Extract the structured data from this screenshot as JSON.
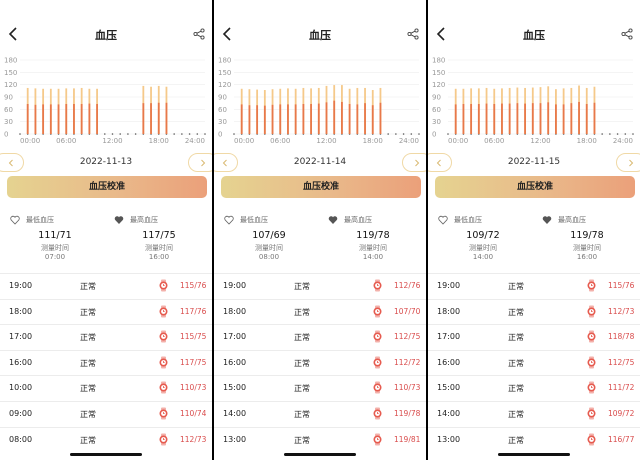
{
  "ui": {
    "title": "血压",
    "calibrate_label": "血压校准",
    "min_label": "最低血压",
    "max_label": "最高血压",
    "measure_time_label": "测量时间",
    "accent_color": "#e65a4e",
    "bar_color": "#e8784a",
    "bar_tip_color": "#f5c98a",
    "icons": [
      "back-arrow-icon",
      "share-icon",
      "chevron-left-icon",
      "chevron-right-icon",
      "heart-outline-icon",
      "heart-filled-icon",
      "watch-icon"
    ]
  },
  "panels": [
    {
      "date": "2022-11-13",
      "min": {
        "value": "111/71",
        "time": "07:00"
      },
      "max": {
        "value": "117/75",
        "time": "16:00"
      },
      "rows": [
        {
          "time": "19:00",
          "status": "正常",
          "value": "115/76"
        },
        {
          "time": "18:00",
          "status": "正常",
          "value": "117/76"
        },
        {
          "time": "17:00",
          "status": "正常",
          "value": "115/75"
        },
        {
          "time": "16:00",
          "status": "正常",
          "value": "117/75"
        },
        {
          "time": "10:00",
          "status": "正常",
          "value": "110/73"
        },
        {
          "time": "09:00",
          "status": "正常",
          "value": "110/74"
        },
        {
          "time": "08:00",
          "status": "正常",
          "value": "112/73"
        }
      ]
    },
    {
      "date": "2022-11-14",
      "min": {
        "value": "107/69",
        "time": "08:00"
      },
      "max": {
        "value": "119/78",
        "time": "14:00"
      },
      "rows": [
        {
          "time": "19:00",
          "status": "正常",
          "value": "112/76"
        },
        {
          "time": "18:00",
          "status": "正常",
          "value": "107/70"
        },
        {
          "time": "17:00",
          "status": "正常",
          "value": "112/75"
        },
        {
          "time": "16:00",
          "status": "正常",
          "value": "112/72"
        },
        {
          "time": "15:00",
          "status": "正常",
          "value": "110/73"
        },
        {
          "time": "14:00",
          "status": "正常",
          "value": "119/78"
        },
        {
          "time": "13:00",
          "status": "正常",
          "value": "119/81"
        }
      ]
    },
    {
      "date": "2022-11-15",
      "min": {
        "value": "109/72",
        "time": "14:00"
      },
      "max": {
        "value": "119/78",
        "time": "16:00"
      },
      "rows": [
        {
          "time": "19:00",
          "status": "正常",
          "value": "115/76"
        },
        {
          "time": "18:00",
          "status": "正常",
          "value": "112/73"
        },
        {
          "time": "17:00",
          "status": "正常",
          "value": "118/78"
        },
        {
          "time": "16:00",
          "status": "正常",
          "value": "112/75"
        },
        {
          "time": "15:00",
          "status": "正常",
          "value": "111/72"
        },
        {
          "time": "14:00",
          "status": "正常",
          "value": "109/72"
        },
        {
          "time": "13:00",
          "status": "正常",
          "value": "116/77"
        }
      ]
    }
  ],
  "chart_data": [
    {
      "type": "bar",
      "title": "",
      "y_ticks": [
        "0",
        "30",
        "60",
        "90",
        "120",
        "150",
        "180"
      ],
      "x_ticks": [
        "00:00",
        "06:00",
        "12:00",
        "18:00",
        "24:00"
      ],
      "ylim": [
        0,
        180
      ],
      "xlim": [
        0,
        24
      ],
      "grid": true,
      "x": [
        1,
        2,
        3,
        4,
        5,
        6,
        7,
        8,
        9,
        10,
        16,
        17,
        18,
        19
      ],
      "series": [
        {
          "values": [
            112,
            111,
            110,
            110,
            110,
            111,
            111,
            112,
            110,
            110,
            117,
            115,
            117,
            115
          ]
        },
        {
          "values": [
            73,
            71,
            72,
            72,
            72,
            73,
            73,
            73,
            74,
            73,
            75,
            75,
            76,
            76
          ]
        }
      ]
    },
    {
      "type": "bar",
      "title": "",
      "y_ticks": [
        "0",
        "30",
        "60",
        "90",
        "120",
        "150",
        "180"
      ],
      "x_ticks": [
        "00:00",
        "06:00",
        "12:00",
        "18:00",
        "24:00"
      ],
      "ylim": [
        0,
        180
      ],
      "xlim": [
        0,
        24
      ],
      "grid": true,
      "x": [
        1,
        2,
        3,
        4,
        5,
        6,
        7,
        8,
        9,
        10,
        11,
        12,
        13,
        14,
        15,
        16,
        17,
        18,
        19
      ],
      "series": [
        {
          "values": [
            110,
            109,
            108,
            107,
            109,
            110,
            111,
            110,
            112,
            111,
            112,
            117,
            119,
            119,
            110,
            112,
            112,
            107,
            112
          ]
        },
        {
          "values": [
            72,
            70,
            70,
            69,
            71,
            72,
            72,
            72,
            73,
            73,
            74,
            77,
            81,
            78,
            73,
            72,
            75,
            70,
            76
          ]
        }
      ]
    },
    {
      "type": "bar",
      "title": "",
      "y_ticks": [
        "0",
        "30",
        "60",
        "90",
        "120",
        "150",
        "180"
      ],
      "x_ticks": [
        "00:00",
        "06:00",
        "12:00",
        "18:00",
        "24:00"
      ],
      "ylim": [
        0,
        180
      ],
      "xlim": [
        0,
        24
      ],
      "grid": true,
      "x": [
        1,
        2,
        3,
        4,
        5,
        6,
        7,
        8,
        9,
        10,
        11,
        12,
        13,
        14,
        15,
        16,
        17,
        18,
        19
      ],
      "series": [
        {
          "values": [
            110,
            110,
            111,
            111,
            112,
            110,
            111,
            112,
            113,
            112,
            113,
            114,
            116,
            109,
            111,
            112,
            118,
            112,
            115
          ]
        },
        {
          "values": [
            72,
            73,
            73,
            73,
            74,
            73,
            74,
            74,
            75,
            74,
            75,
            75,
            77,
            72,
            72,
            75,
            78,
            73,
            76
          ]
        }
      ]
    }
  ]
}
